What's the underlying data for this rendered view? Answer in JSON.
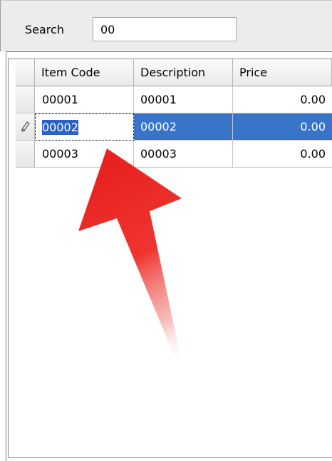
{
  "search": {
    "label": "Search",
    "value": "00"
  },
  "grid": {
    "columns": [
      "Item Code",
      "Description",
      "Price"
    ],
    "rows": [
      {
        "code": "00001",
        "description": "00001",
        "price": "0.00"
      },
      {
        "code": "00002",
        "description": "00002",
        "price": "0.00"
      },
      {
        "code": "00003",
        "description": "00003",
        "price": "0.00"
      }
    ],
    "selected_row": 1,
    "editing_indicator": "pencil-icon"
  },
  "annotation": {
    "arrow_color": "#e8231f",
    "icon": "arrow-pointer-icon"
  },
  "colors": {
    "selection": "#3874c8",
    "panel": "#ececec"
  }
}
